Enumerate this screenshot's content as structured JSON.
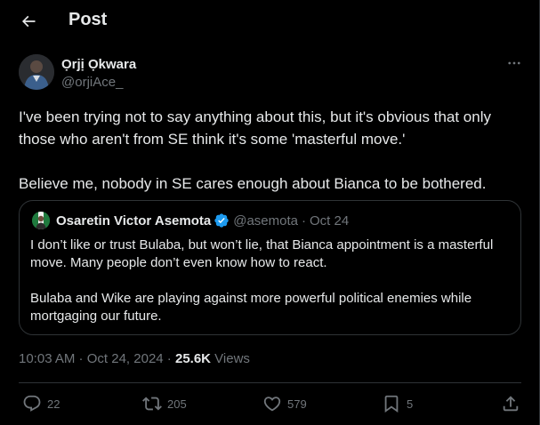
{
  "header": {
    "title": "Post",
    "back_icon": "arrow-left-icon"
  },
  "post": {
    "author": {
      "name": "Ọrjị Ọkwara",
      "handle": "@orjiAce_"
    },
    "more_icon": "more-horizontal-icon",
    "text_line1": "I've been trying not to say anything about this, but it's obvious that only those who aren't from SE think it's some 'masterful move.'",
    "text_line2": "Believe me, nobody in SE cares enough about Bianca to be bothered.",
    "quote": {
      "name": "Osaretin Victor Asemota",
      "verified_icon": "verified-badge-icon",
      "handle": "@asemota",
      "separator": "·",
      "date": "Oct 24",
      "paragraph1": "I don’t like or trust Bulaba, but won’t lie, that Bianca appointment is a masterful move. Many people don’t even know how to react.",
      "paragraph2": "Bulaba and Wike are playing against more powerful political enemies while mortgaging our future."
    },
    "timestamp": {
      "time": "10:03 AM",
      "separator1": " · ",
      "date": "Oct 24, 2024",
      "separator2": " · ",
      "views_count": "25.6K",
      "views_label": " Views"
    },
    "actions": {
      "replies": "22",
      "reposts": "205",
      "likes": "579",
      "bookmarks": "5"
    }
  },
  "colors": {
    "background": "#000000",
    "text_primary": "#e7e9ea",
    "text_secondary": "#71767b",
    "border": "#2f3336",
    "verified": "#1d9bf0"
  }
}
